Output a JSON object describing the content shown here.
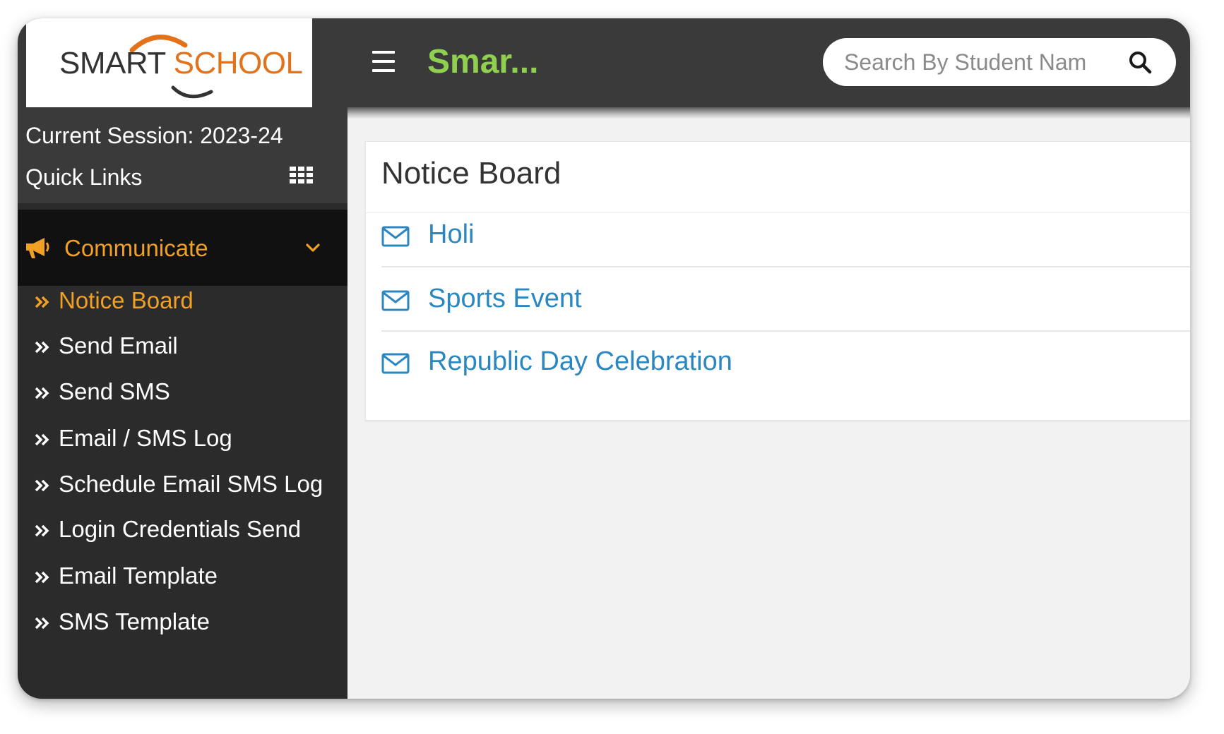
{
  "header": {
    "logo": {
      "part1": "SMART",
      "part2": "SCHOOL"
    },
    "app_title": "Smar...",
    "search": {
      "placeholder": "Search By Student Nam",
      "value": ""
    }
  },
  "sidebar": {
    "session": "Current Session: 2023-24",
    "quick_links": "Quick Links",
    "section": {
      "label": "Communicate",
      "icon": "megaphone-icon",
      "expanded": true
    },
    "items": [
      {
        "label": "Notice Board",
        "active": true
      },
      {
        "label": "Send Email",
        "active": false
      },
      {
        "label": "Send SMS",
        "active": false
      },
      {
        "label": "Email / SMS Log",
        "active": false
      },
      {
        "label": "Schedule Email SMS Log",
        "active": false
      },
      {
        "label": "Login Credentials Send",
        "active": false
      },
      {
        "label": "Email Template",
        "active": false
      },
      {
        "label": "SMS Template",
        "active": false
      }
    ]
  },
  "main": {
    "title": "Notice Board",
    "notices": [
      {
        "title": "Holi",
        "icon": "envelope-icon"
      },
      {
        "title": "Sports Event",
        "icon": "envelope-icon"
      },
      {
        "title": "Republic Day Celebration",
        "icon": "envelope-icon"
      }
    ]
  },
  "colors": {
    "header_bg": "#3a3a3a",
    "sidebar_bg": "#2b2b2b",
    "section_bg": "#111111",
    "accent_orange": "#f0a024",
    "title_green": "#8fd14f",
    "link_blue": "#2a87c2"
  }
}
